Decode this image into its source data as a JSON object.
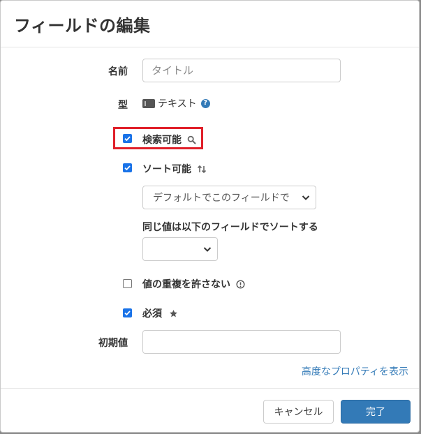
{
  "dialog": {
    "title": "フィールドの編集"
  },
  "form": {
    "name_label": "名前",
    "name_placeholder": "タイトル",
    "type_label": "型",
    "type_value": "テキスト",
    "type_help_icon": "question-circle-icon",
    "searchable": {
      "label": "検索可能",
      "checked": true,
      "icon": "search-icon",
      "highlighted": true
    },
    "sortable": {
      "label": "ソート可能",
      "checked": true,
      "icon": "sort-arrows-icon",
      "sort_select_value": "デフォルトでこのフィールドで",
      "tie_break_label": "同じ値は以下のフィールドでソートする",
      "tie_break_select_value": ""
    },
    "unique": {
      "label": "値の重複を許さない",
      "checked": false,
      "icon": "exclamation-circle-icon"
    },
    "required": {
      "label": "必須",
      "checked": true,
      "icon": "star-icon"
    },
    "default_value_label": "初期値",
    "default_value": ""
  },
  "advanced_link": "高度なプロパティを表示",
  "footer": {
    "cancel_label": "キャンセル",
    "done_label": "完了"
  },
  "colors": {
    "primary": "#337ab7",
    "checkbox": "#1a73e8",
    "highlight": "#e0202a"
  }
}
